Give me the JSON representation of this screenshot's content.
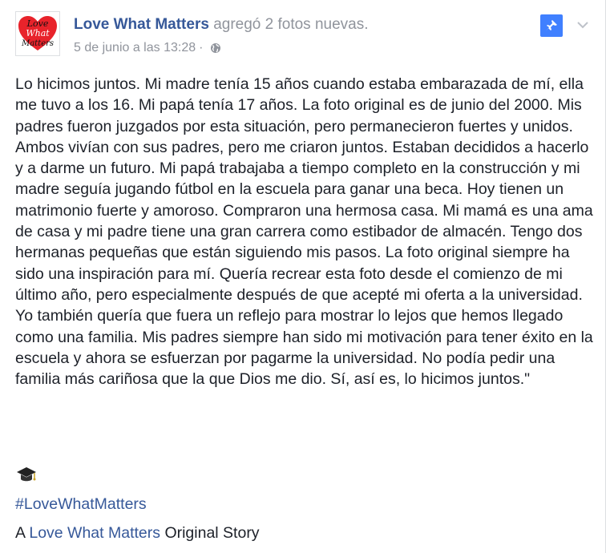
{
  "post": {
    "page_name": "Love What Matters",
    "action_text": "agregó 2 fotos nuevas.",
    "timestamp": "5 de junio a las 13:28",
    "separator": "·",
    "audience_icon": "globe-icon",
    "body": "Lo hicimos juntos. Mi madre tenía 15 años cuando estaba embarazada de mí, ella me tuvo a los 16. Mi papá tenía 17 años. La foto original es de junio del 2000. Mis padres fueron juzgados por esta situación, pero permanecieron fuertes y unidos. Ambos vivían con sus padres, pero me criaron juntos. Estaban decididos a hacerlo y a darme un futuro. Mi papá trabajaba a tiempo completo en la construcción y mi madre seguía jugando fútbol en la escuela para ganar una beca. Hoy tienen un matrimonio fuerte y amoroso. Compraron una hermosa casa. Mi mamá es una ama de casa y mi padre tiene una gran carrera como estibador de almacén. Tengo dos hermanas pequeñas que están siguiendo mis pasos. La foto original siempre ha sido una inspiración para mí. Quería recrear esta foto desde el comienzo de mi último año, pero especialmente después de que acepté mi oferta a la universidad. Yo también quería que fuera un reflejo para mostrar lo lejos que hemos llegado como una familia. Mis padres siempre han sido mi motivación para tener éxito en la escuela y ahora se esfuerzan por pagarme la universidad. No podía pedir una familia más cariñosa que la que Dios me dio. Sí, así es, lo hicimos juntos.\"",
    "emoji_icon": "graduation-cap-icon",
    "hashtag": "#LoveWhatMatters",
    "credit_prefix": "A",
    "credit_link": "Love What Matters",
    "credit_suffix": "Original Story"
  },
  "avatar": {
    "logo_text_1": "Love",
    "logo_text_2": "What",
    "logo_text_3": "Matters"
  },
  "colors": {
    "link": "#365899",
    "muted": "#90949c",
    "pin_bg": "#4080ff",
    "logo_heart": "#e8232b"
  }
}
